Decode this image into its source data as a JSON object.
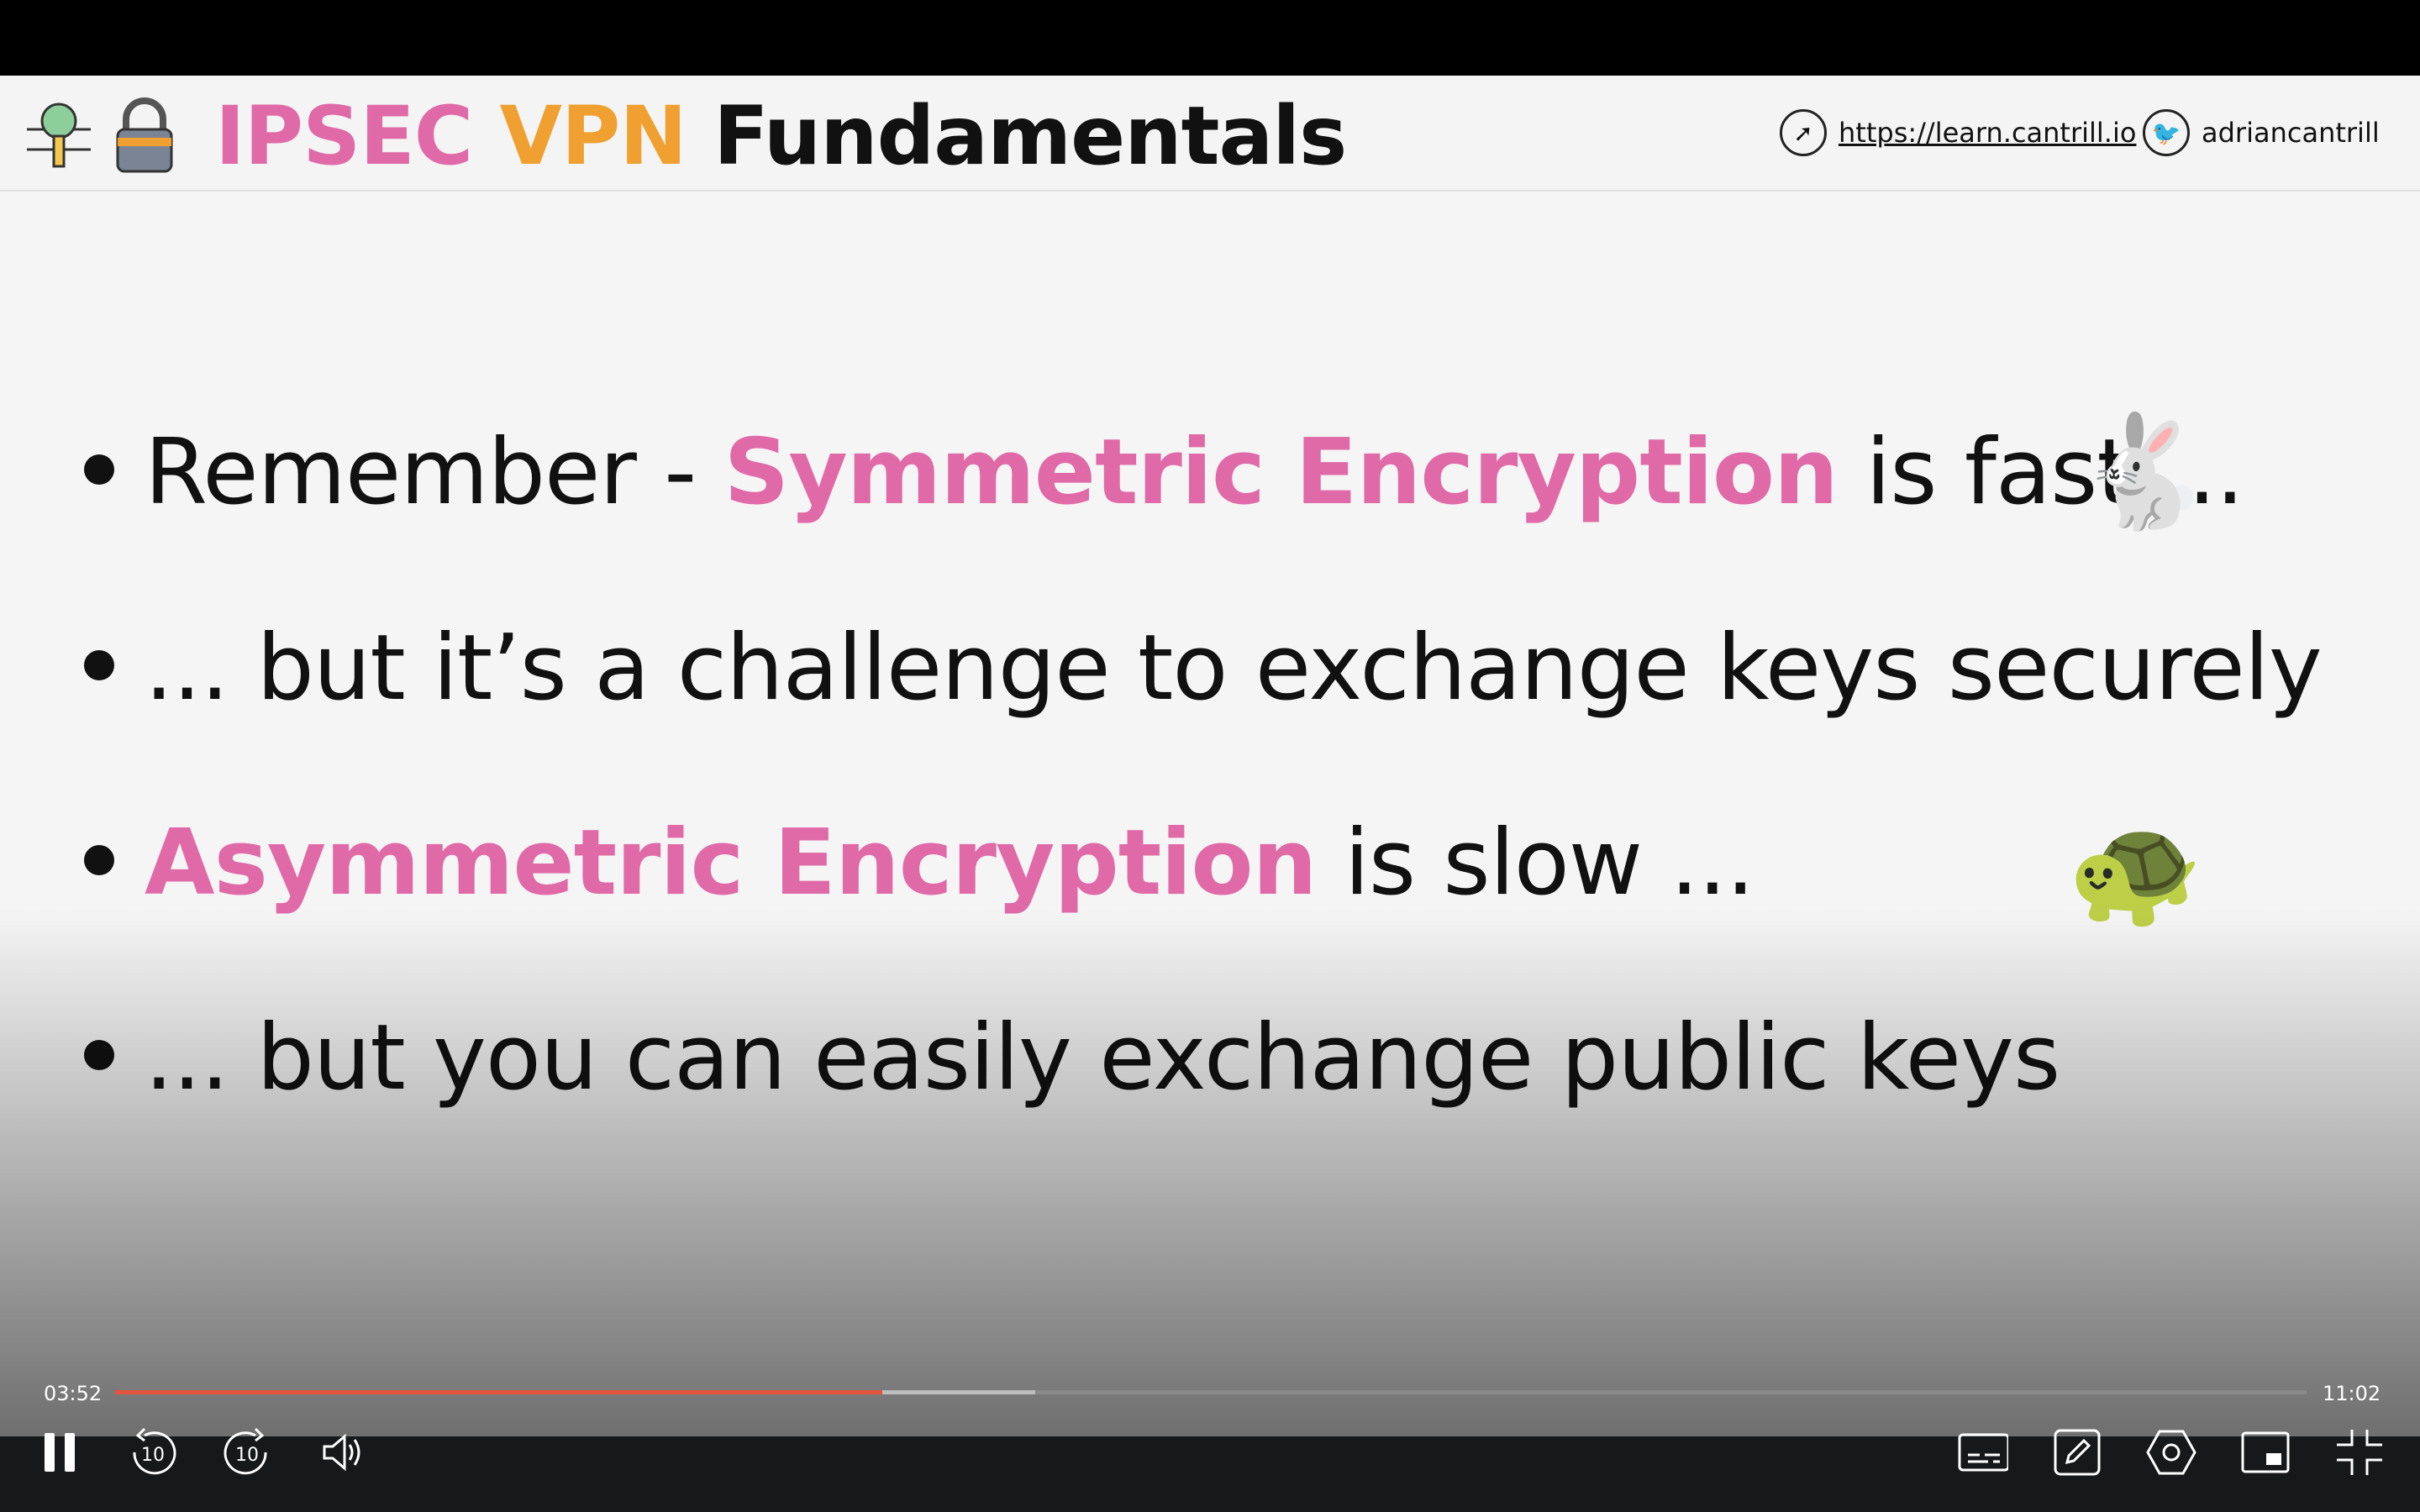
{
  "header": {
    "title_part1": "IPSEC",
    "title_part2": "VPN",
    "title_part3": "Fundamentals",
    "website": "https://learn.cantrill.io",
    "twitter": "adriancantrill"
  },
  "bullets": [
    {
      "pre": "Remember - ",
      "highlight": "Symmetric Encryption",
      "post": " is fast ..."
    },
    {
      "pre": "... but it’s a challenge to exchange keys securely",
      "highlight": "",
      "post": ""
    },
    {
      "pre": "",
      "highlight": "Asymmetric Encryption",
      "post": " is slow ..."
    },
    {
      "pre": "... but you can easily exchange public keys",
      "highlight": "",
      "post": ""
    }
  ],
  "player": {
    "current_time": "03:52",
    "duration": "11:02",
    "progress_percent": 35,
    "buffered_percent": 42,
    "skip_back_label": "10",
    "skip_forward_label": "10"
  },
  "colors": {
    "highlight": "#e06aa8",
    "vpn": "#f0a030",
    "progress": "#e2553a"
  }
}
